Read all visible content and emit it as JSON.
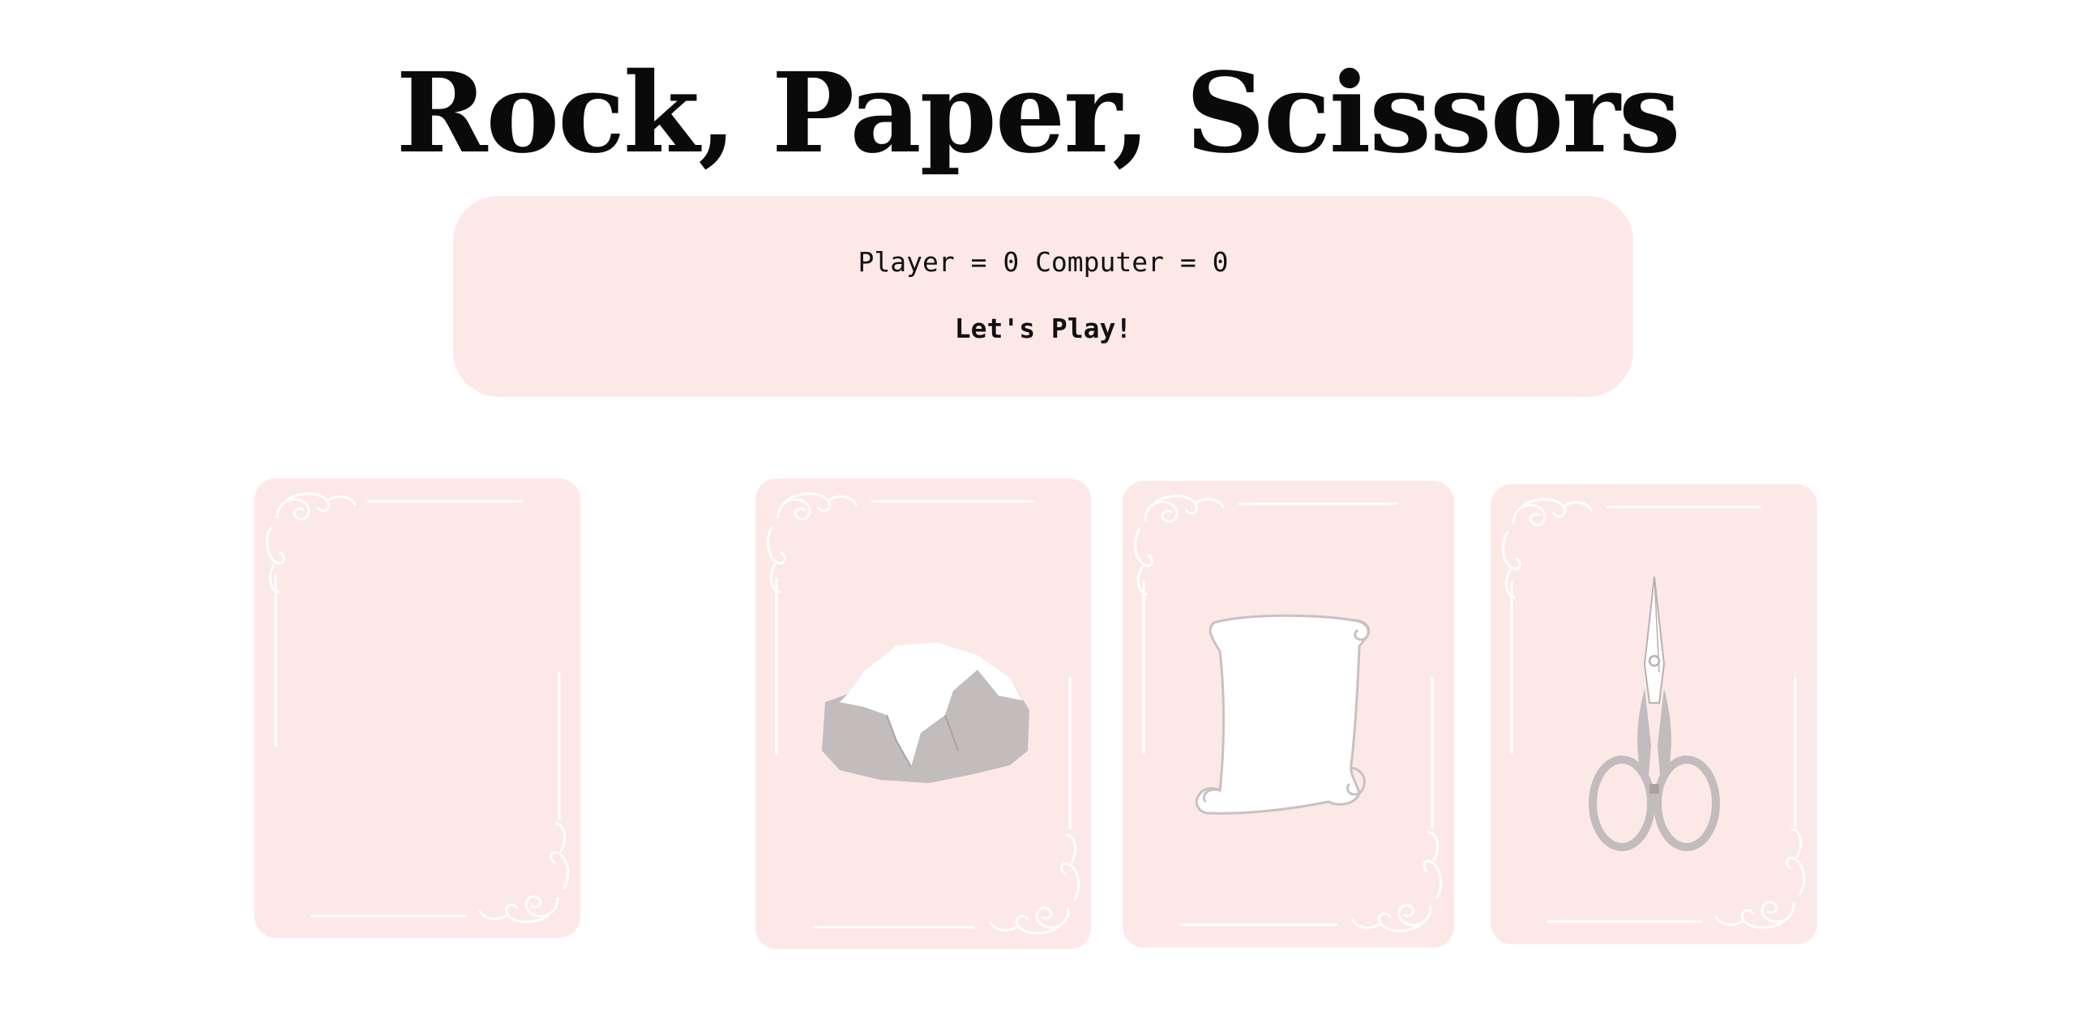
{
  "game": {
    "title": "Rock, Paper, Scissors"
  },
  "score": {
    "player_label": "Player",
    "player_value": "0",
    "computer_label": "Computer",
    "computer_value": "0"
  },
  "status": {
    "message": "Let's Play!"
  },
  "cards": [
    {
      "role": "computer-choice",
      "icon": "empty"
    },
    {
      "role": "player-choice",
      "icon": "rock-icon"
    },
    {
      "role": "player-choice",
      "icon": "paper-icon"
    },
    {
      "role": "player-choice",
      "icon": "scissors-icon"
    }
  ],
  "colors": {
    "card_background": "#fde8e8",
    "panel_background": "#fde8e8",
    "ornament": "#ffffff",
    "icon_gray": "#c2bcbc",
    "title": "#0a0a0a"
  }
}
